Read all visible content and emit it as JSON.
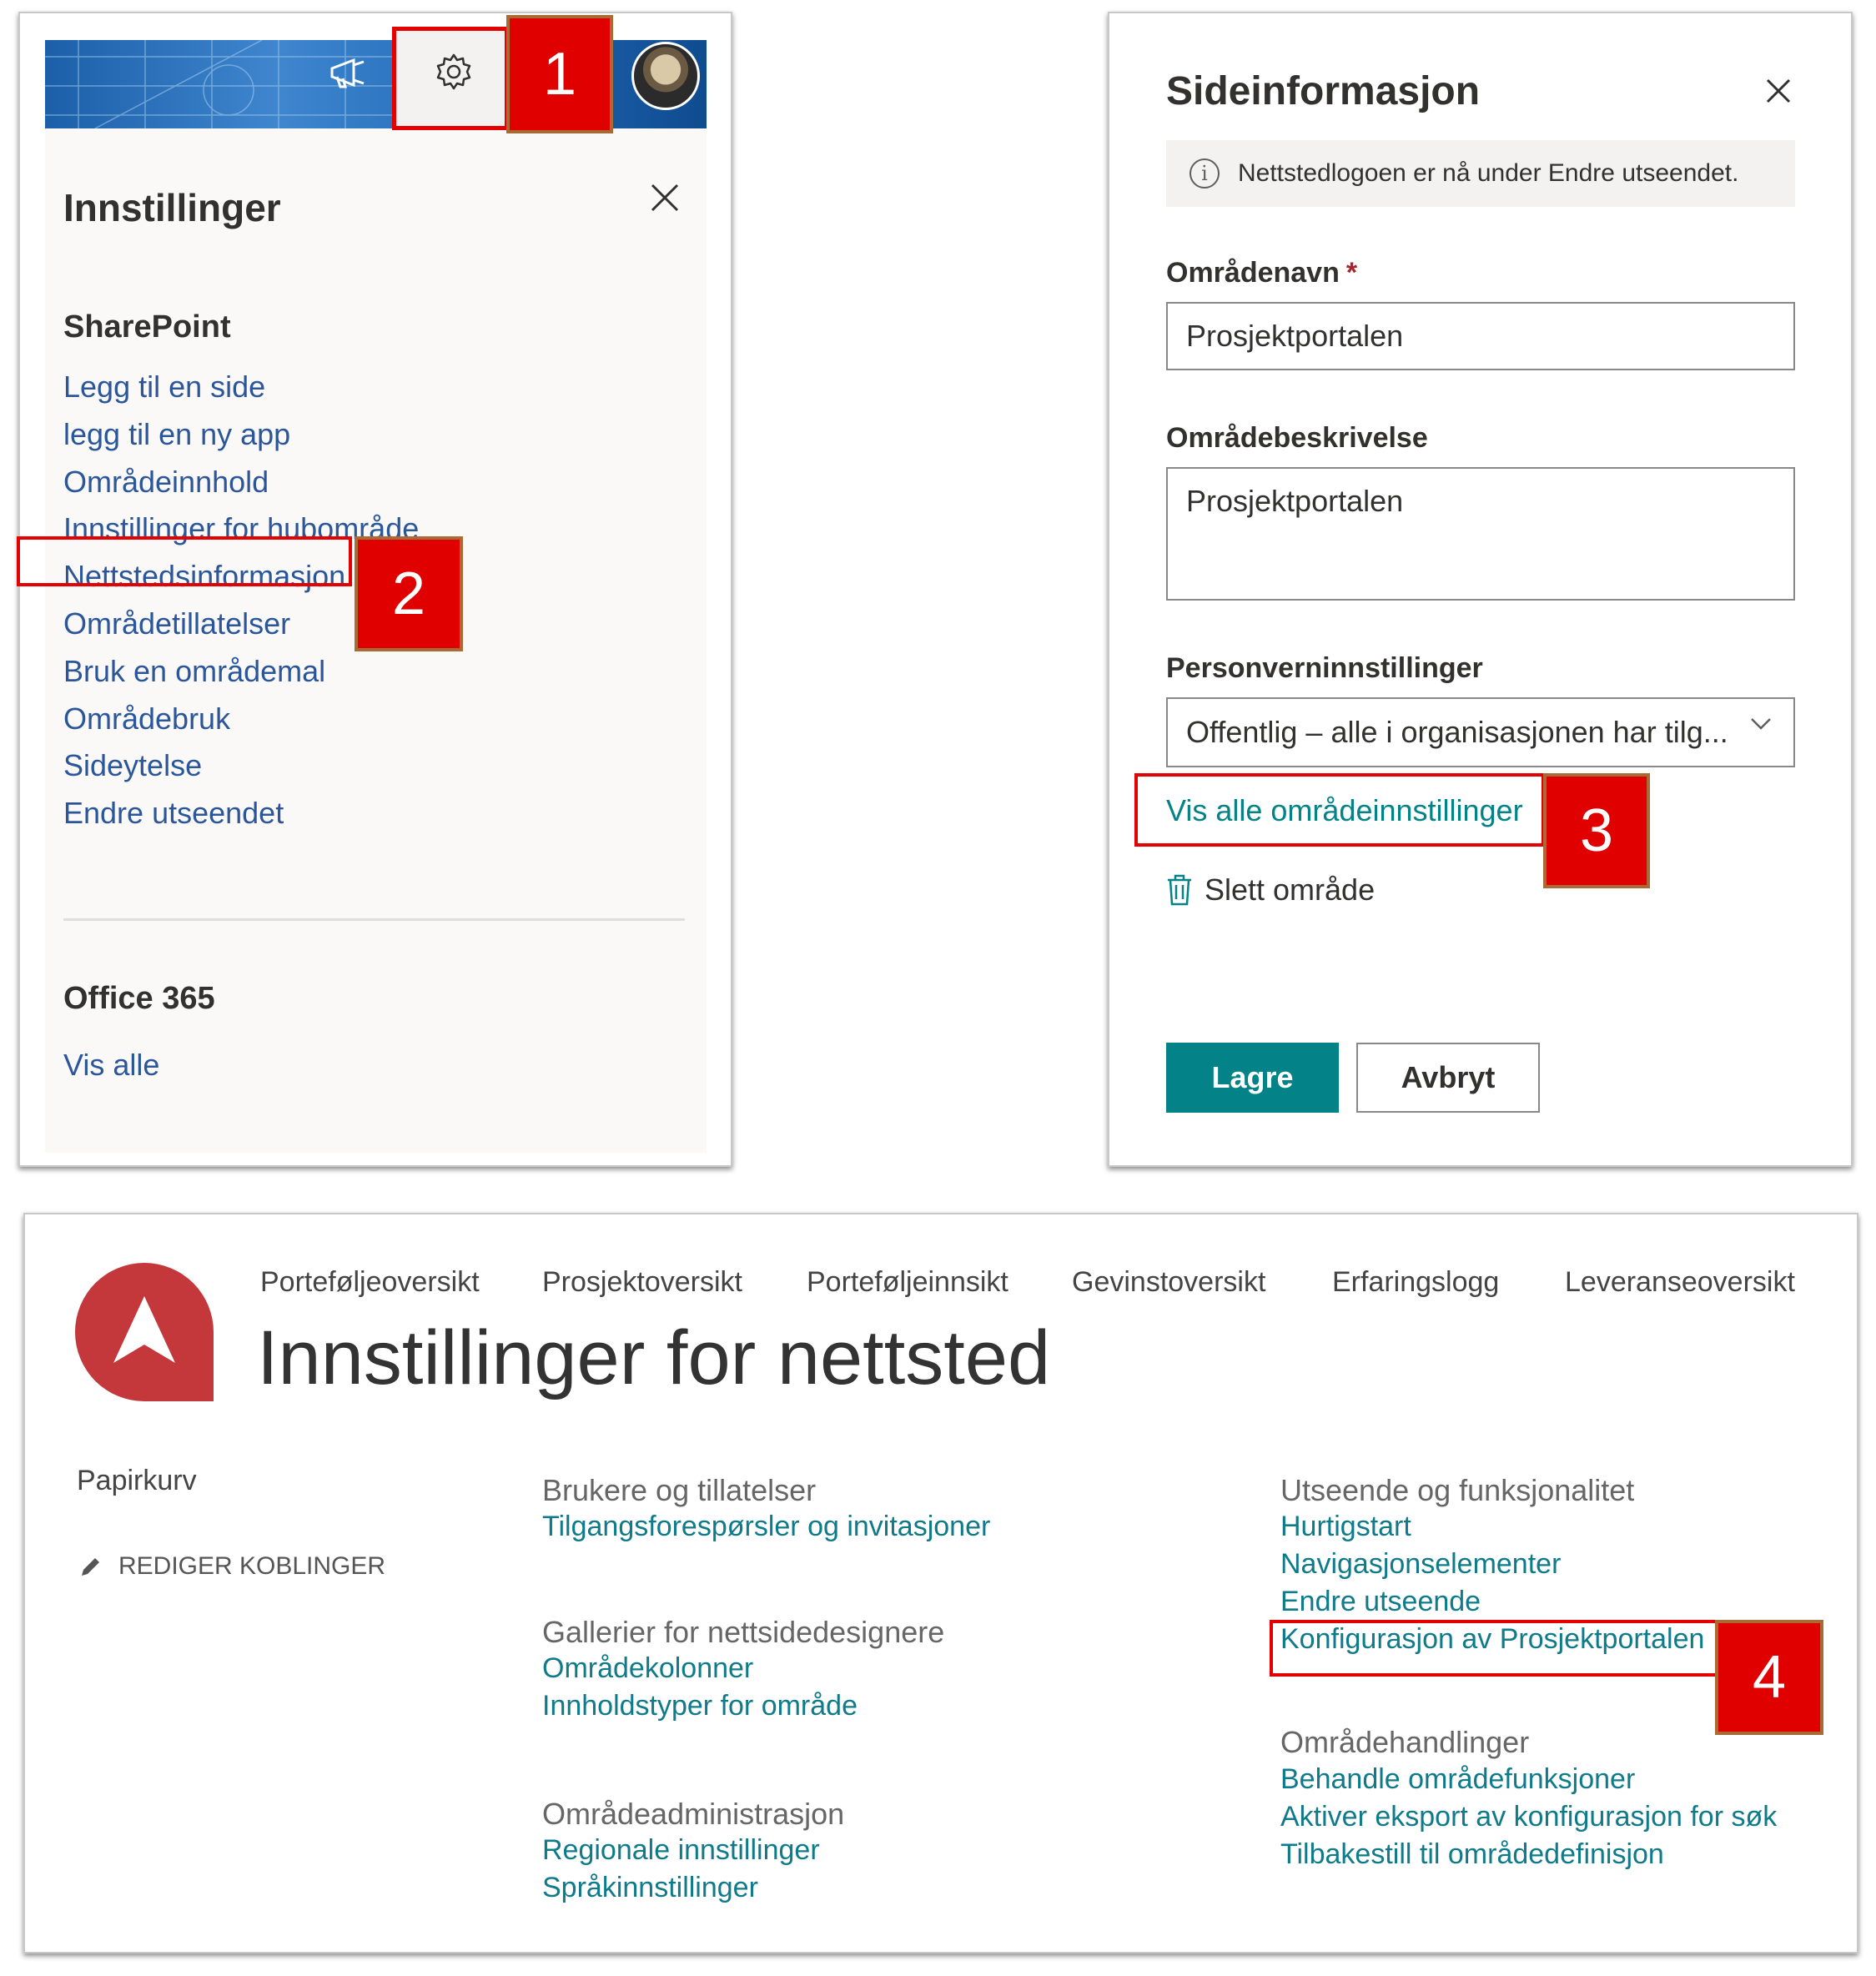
{
  "badges": {
    "b1": "1",
    "b2": "2",
    "b3": "3",
    "b4": "4"
  },
  "settings_panel": {
    "title": "Innstillinger",
    "sharepoint_heading": "SharePoint",
    "items": [
      "Legg til en side",
      "legg til en ny app",
      "Områdeinnhold",
      "Innstillinger for hubområde",
      "Nettstedsinformasjon",
      "Områdetillatelser",
      "Bruk en områdemal",
      "Områdebruk",
      "Sideytelse",
      "Endre utseendet"
    ],
    "office_heading": "Office 365",
    "vis_alle": "Vis alle"
  },
  "site_info_panel": {
    "title": "Sideinformasjon",
    "info_text": "Nettstedlogoen er nå under Endre utseendet.",
    "name_label": "Områdenavn",
    "required_mark": "*",
    "name_value": "Prosjektportalen",
    "description_label": "Områdebeskrivelse",
    "description_value": "Prosjektportalen",
    "privacy_label": "Personverninnstillinger",
    "privacy_value": "Offentlig – alle i organisasjonen har tilg...",
    "view_all_link": "Vis alle områdeinnstillinger",
    "delete_label": "Slett område",
    "save_button": "Lagre",
    "cancel_button": "Avbryt"
  },
  "site_settings_page": {
    "nav": [
      "Porteføljeoversikt",
      "Prosjektoversikt",
      "Porteføljeinnsikt",
      "Gevinstoversikt",
      "Erfaringslogg",
      "Leveranseoversikt"
    ],
    "title": "Innstillinger for nettsted",
    "left_nav": {
      "recycle": "Papirkurv",
      "edit_links": "REDIGER KOBLINGER"
    },
    "groups": {
      "users": {
        "heading": "Brukere og tillatelser",
        "links": [
          "Tilgangsforespørsler og invitasjoner"
        ]
      },
      "galleries": {
        "heading": "Gallerier for nettsidedesignere",
        "links": [
          "Områdekolonner",
          "Innholdstyper for område"
        ]
      },
      "admin": {
        "heading": "Områdeadministrasjon",
        "links": [
          "Regionale innstillinger",
          "Språkinnstillinger"
        ]
      },
      "look": {
        "heading": "Utseende og funksjonalitet",
        "links": [
          "Hurtigstart",
          "Navigasjonselementer",
          "Endre utseende",
          "Konfigurasjon av Prosjektportalen"
        ]
      },
      "actions": {
        "heading": "Områdehandlinger",
        "links": [
          "Behandle områdefunksjoner",
          "Aktiver eksport av konfigurasjon for søk",
          "Tilbakestill til områdedefinisjon"
        ]
      }
    }
  },
  "colors": {
    "highlight": "#e50000",
    "link_blue": "#2b579a",
    "teal": "#038387",
    "logo_red": "#c4373a"
  }
}
